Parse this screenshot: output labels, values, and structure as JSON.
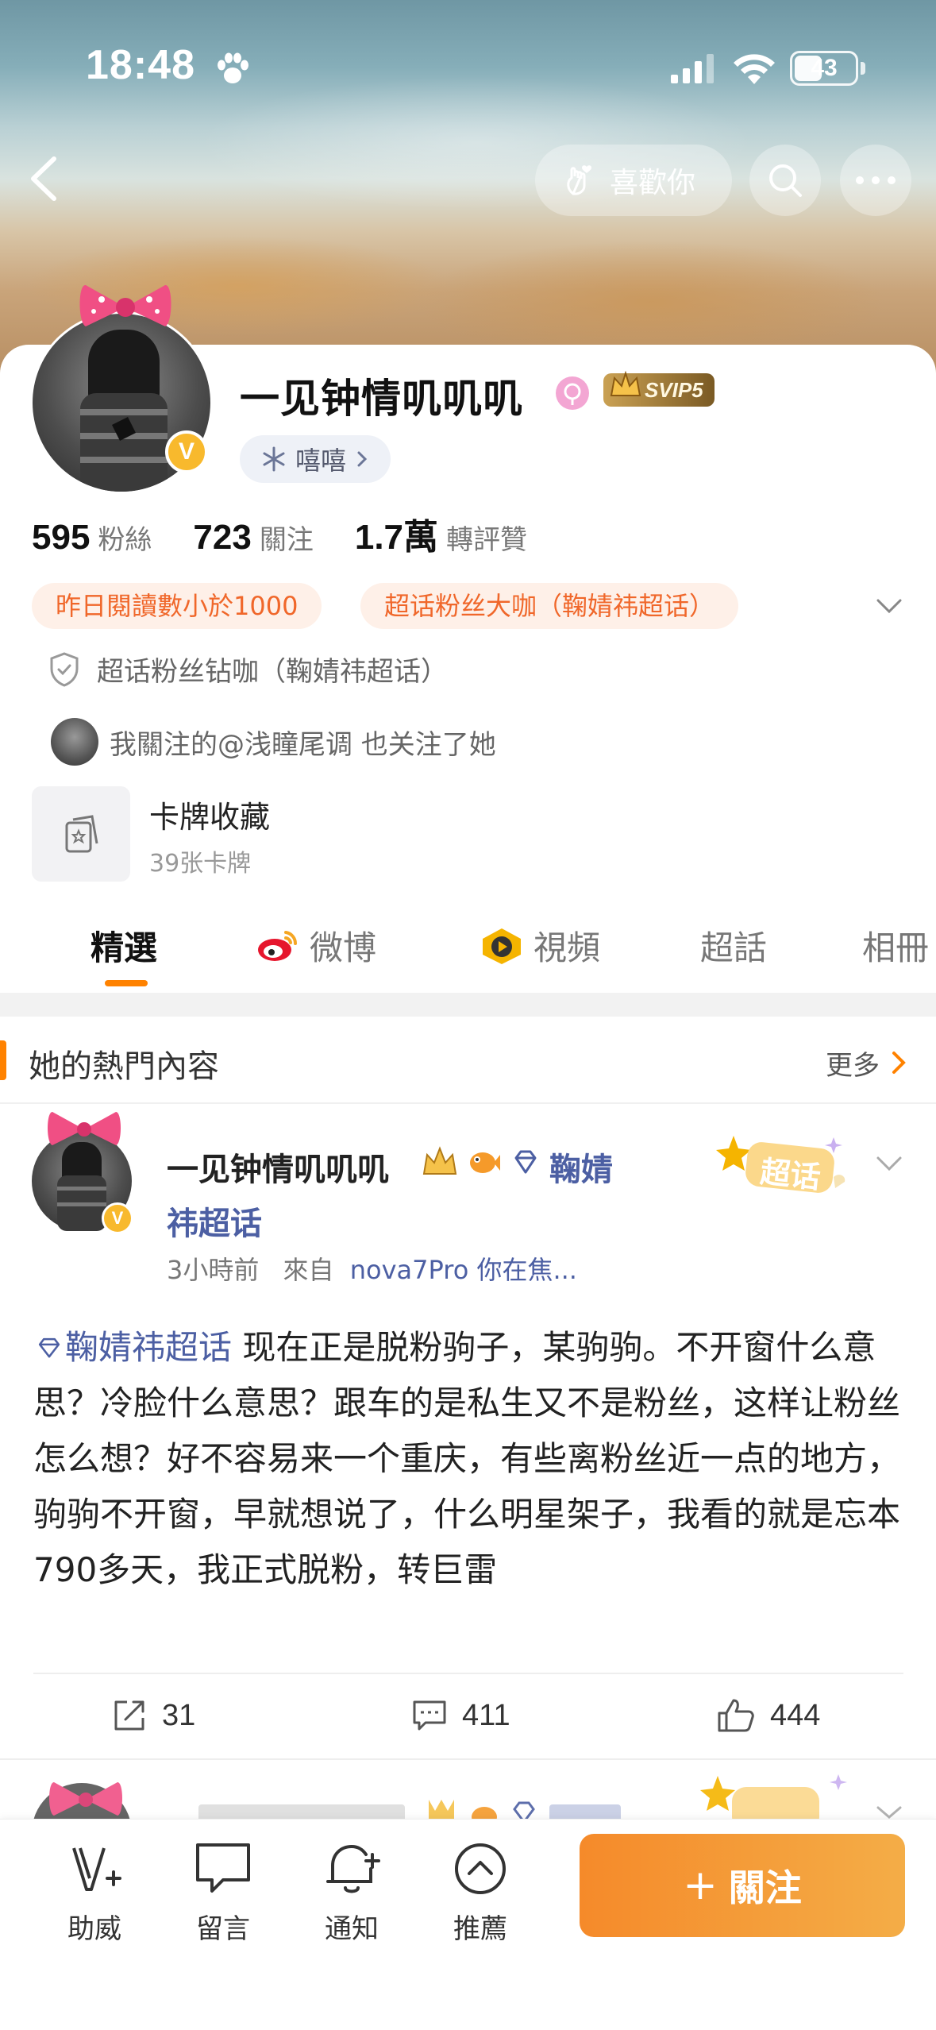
{
  "status_bar": {
    "time": "18:48",
    "battery": "43"
  },
  "header": {
    "like_label": "喜歡你"
  },
  "profile": {
    "name": "一见钟情叽叽叽",
    "vip": "SVIP5",
    "tag": "嘻嘻",
    "stats": [
      {
        "num": "595",
        "label": "粉絲"
      },
      {
        "num": "723",
        "label": "關注"
      },
      {
        "num": "1.7萬",
        "label": "轉評贊"
      }
    ],
    "badges": [
      "昨日閱讀數小於1000",
      "超话粉丝大咖（鞠婧祎超话）"
    ],
    "super_fan": "超话粉丝钻咖（鞠婧祎超话）",
    "mutual": "我關注的@浅瞳尾调 也关注了她",
    "card_collection": {
      "title": "卡牌收藏",
      "sub": "39张卡牌"
    }
  },
  "tabs": [
    "精選",
    "微博",
    "視頻",
    "超話",
    "相冊"
  ],
  "section": {
    "title": "她的熱門內容",
    "more": "更多"
  },
  "post": {
    "author": "一见钟情叽叽叽",
    "topic_a": "鞠婧",
    "topic_b": "祎超话",
    "sticker": "超话",
    "time": "3小時前",
    "from": "來自",
    "source": "nova7Pro 你在焦...",
    "text_topic": "鞠婧祎超话",
    "text": " 现在正是脱粉驹子，某驹驹。不开窗什么意思？冷脸什么意思？跟车的是私生又不是粉丝，这样让粉丝怎么想？好不容易来一个重庆，有些离粉丝近一点的地方，驹驹不开窗，早就想说了，什么明星架子，我看的就是忘本790多天，我正式脱粉，转巨雷",
    "reposts": "31",
    "comments": "411",
    "likes": "444"
  },
  "toolbar": {
    "items": [
      "助威",
      "留言",
      "通知",
      "推薦"
    ],
    "follow": "關注"
  },
  "colors": {
    "accent": "#ff8200",
    "link": "#4c5fa3",
    "badge_bg": "#fef0e8",
    "badge_text": "#f0672a"
  }
}
